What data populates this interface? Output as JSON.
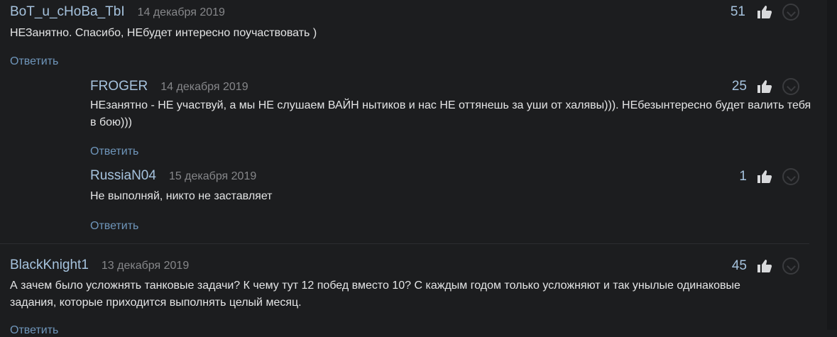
{
  "comments": [
    {
      "author": "BoT_u_cHoBa_TbI",
      "date": "14 декабря 2019",
      "text": "НЕЗанятно. Спасибо, НЕбудет интересно поучаствовать )",
      "likes": "51",
      "reply": "Ответить"
    },
    {
      "author": "FROGER",
      "date": "14 декабря 2019",
      "text": "НЕзанятно - НЕ участвуй, а мы НЕ слушаем ВАЙН нытиков и нас НЕ оттянешь за уши от халявы))). НЕбезынтересно будет валить тебя в бою)))",
      "likes": "25",
      "reply": "Ответить"
    },
    {
      "author": "RussiaN04",
      "date": "15 декабря 2019",
      "text": "Не выполняй, никто не заставляет",
      "likes": "1",
      "reply": "Ответить"
    },
    {
      "author": "BlackKnight1",
      "date": "13 декабря 2019",
      "text": "А зачем было усложнять танковые задачи? К чему тут 12 побед вместо 10? С каждым годом только усложняют и так унылые одинаковые задания, которые приходится выполнять целый месяц.",
      "likes": "45",
      "reply": "Ответить"
    }
  ],
  "icons": {
    "like": "thumbs-up-icon",
    "dislike": "chevron-down-circle-icon"
  },
  "colors": {
    "background": "#1c1d1f",
    "author": "#a6c3de",
    "reply": "#6f96bb",
    "text": "#e4e5e6",
    "date": "#86878a"
  }
}
